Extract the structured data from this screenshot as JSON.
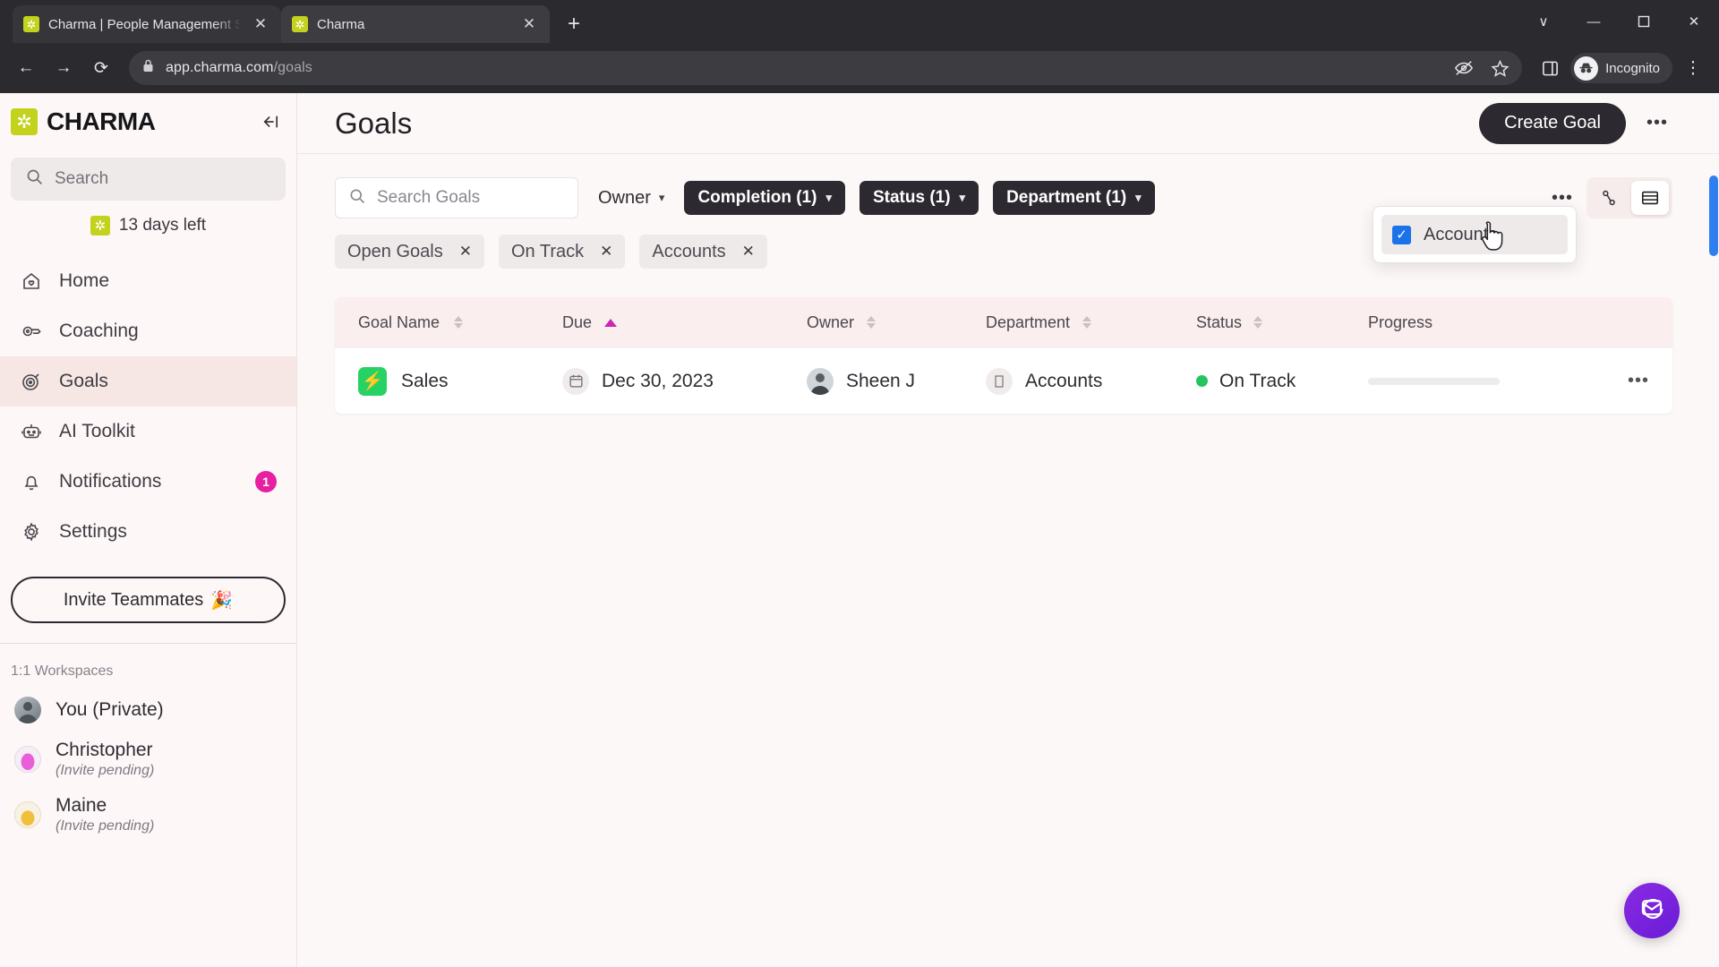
{
  "browser": {
    "tabs": [
      {
        "title": "Charma | People Management S",
        "favicon": "charma-star-icon",
        "active": false
      },
      {
        "title": "Charma",
        "favicon": "charma-star-icon",
        "active": true
      }
    ],
    "new_tab_label": "+",
    "window_controls": {
      "minimize": "—",
      "maximize": "❐",
      "close": "✕",
      "chevron": "∨"
    },
    "nav": {
      "back": "←",
      "forward": "→",
      "reload": "⟳"
    },
    "url_prefix": "app.charma.com",
    "url_path": "/goals",
    "lock_icon": "lock-icon",
    "profile_label": "Incognito",
    "toolbar_icons": [
      "eye-off-icon",
      "star-icon",
      "side-panel-icon",
      "incognito-icon",
      "menu-icon"
    ]
  },
  "sidebar": {
    "brand": "CHARMA",
    "collapse_icon": "collapse-sidebar-icon",
    "search_placeholder": "Search",
    "trial": "13 days left",
    "nav_items": [
      {
        "label": "Home",
        "icon": "home-icon",
        "active": false,
        "badge": ""
      },
      {
        "label": "Coaching",
        "icon": "whistle-icon",
        "active": false,
        "badge": ""
      },
      {
        "label": "Goals",
        "icon": "target-icon",
        "active": true,
        "badge": ""
      },
      {
        "label": "AI Toolkit",
        "icon": "robot-icon",
        "active": false,
        "badge": ""
      },
      {
        "label": "Notifications",
        "icon": "bell-icon",
        "active": false,
        "badge": "1"
      },
      {
        "label": "Settings",
        "icon": "gear-icon",
        "active": false,
        "badge": ""
      }
    ],
    "invite_label": "Invite Teammates",
    "invite_emoji": "🎉",
    "workspaces_label": "1:1 Workspaces",
    "workspaces": [
      {
        "name": "You (Private)",
        "sub": "",
        "avatar_color": "#9aa3a8"
      },
      {
        "name": "Christopher",
        "sub": "(Invite pending)",
        "avatar_color": "#e85fd8"
      },
      {
        "name": "Maine",
        "sub": "(Invite pending)",
        "avatar_color": "#f0c03a"
      }
    ]
  },
  "page": {
    "title": "Goals",
    "create_button": "Create Goal",
    "more_menu": "•••"
  },
  "filters": {
    "search_placeholder": "Search Goals",
    "owner_label": "Owner",
    "pills": [
      {
        "label": "Completion (1)"
      },
      {
        "label": "Status (1)"
      },
      {
        "label": "Department (1)"
      }
    ],
    "chips": [
      {
        "label": "Open Goals"
      },
      {
        "label": "On Track"
      },
      {
        "label": "Accounts"
      }
    ],
    "view_more": "•••",
    "views": [
      {
        "name": "tree-view",
        "active": false
      },
      {
        "name": "table-view",
        "active": true
      }
    ],
    "department_dropdown": {
      "options": [
        {
          "label": "Accounts",
          "checked": true
        }
      ]
    }
  },
  "table": {
    "columns": [
      {
        "label": "Goal Name",
        "sortable": true,
        "sorted": false
      },
      {
        "label": "Due",
        "sortable": true,
        "sorted": true,
        "direction": "asc"
      },
      {
        "label": "Owner",
        "sortable": true,
        "sorted": false
      },
      {
        "label": "Department",
        "sortable": true,
        "sorted": false
      },
      {
        "label": "Status",
        "sortable": true,
        "sorted": false
      },
      {
        "label": "Progress",
        "sortable": false,
        "sorted": false
      }
    ],
    "rows": [
      {
        "goal_name": "Sales",
        "goal_icon": "⚡",
        "due": "Dec 30, 2023",
        "owner": "Sheen J",
        "department": "Accounts",
        "status": "On Track",
        "progress_percent": 3,
        "row_menu": "•••"
      }
    ]
  },
  "support": {
    "fab_icon": "chat-icon"
  },
  "colors": {
    "brand_green": "#c3d21c",
    "accent_dark": "#2c2a30",
    "status_green": "#22c55e",
    "sort_pink": "#c728b4",
    "badge_pink": "#e81fa0",
    "checkbox_blue": "#1a73e8",
    "progress_blue": "#4f7fd4",
    "fab_purple": "#7b2ff7"
  }
}
